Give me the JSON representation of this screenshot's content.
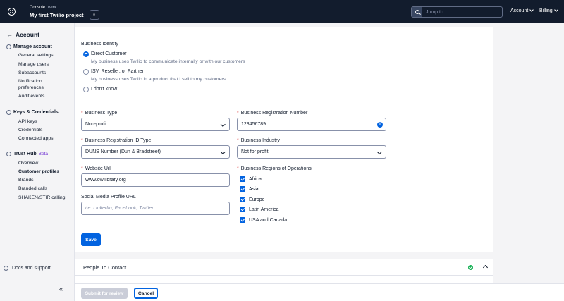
{
  "header": {
    "console_label": "Console",
    "beta_label": "Beta",
    "project_name": "My first Twilio project",
    "search_placeholder": "Jump to...",
    "account_label": "Account",
    "billing_label": "Billing"
  },
  "sidebar": {
    "back_label": "Account",
    "manage_account": {
      "title": "Manage account",
      "items": [
        "General settings",
        "Manage users",
        "Subaccounts",
        "Notification",
        "preferences",
        "Audit events"
      ]
    },
    "keys": {
      "title": "Keys & Credentials",
      "items": [
        "API keys",
        "Credentials",
        "Connected apps"
      ]
    },
    "trust_hub": {
      "title": "Trust Hub",
      "beta": "Beta",
      "items": [
        "Overview",
        "Customer profiles",
        "Brands",
        "Branded calls",
        "SHAKEN/STIR calling"
      ]
    },
    "docs_label": "Docs and support",
    "collapse_glyph": "«"
  },
  "form": {
    "business_identity_label": "Business Identity",
    "identity_options": [
      {
        "label": "Direct Customer",
        "description": "My business uses Twilio to communicate internally or with our customers",
        "selected": true
      },
      {
        "label": "ISV, Reseller, or Partner",
        "description": "My business uses Twilio in a product that I sell to my customers.",
        "selected": false
      },
      {
        "label": "I don't know",
        "description": "",
        "selected": false
      }
    ],
    "business_type": {
      "label": "Business Type",
      "value": "Non-profit"
    },
    "registration_number": {
      "label": "Business Registration Number",
      "value": "123456789"
    },
    "registration_id_type": {
      "label": "Business Registration ID Type",
      "value": "DUNS Number (Dun & Bradstreet)"
    },
    "business_industry": {
      "label": "Business Industry",
      "value": "Not for profit"
    },
    "website_url": {
      "label": "Website Url",
      "value": "www.owllibrary.org"
    },
    "regions": {
      "label": "Business Regions of Operations",
      "options": [
        "Africa",
        "Asia",
        "Europe",
        "Latin America",
        "USA and Canada"
      ]
    },
    "social_media": {
      "label": "Social Media Profile URL",
      "placeholder": "i.e. LinkedIn, Facebook, Twitter"
    },
    "required_mark": "*",
    "info_glyph": "i",
    "save_label": "Save"
  },
  "people_section": {
    "title": "People To Contact"
  },
  "footer": {
    "submit_label": "Submit for review",
    "cancel_label": "Cancel"
  },
  "colors": {
    "primary": "#0263e0",
    "topbar": "#121c2d",
    "required": "#d61f1f",
    "success": "#14b053"
  }
}
